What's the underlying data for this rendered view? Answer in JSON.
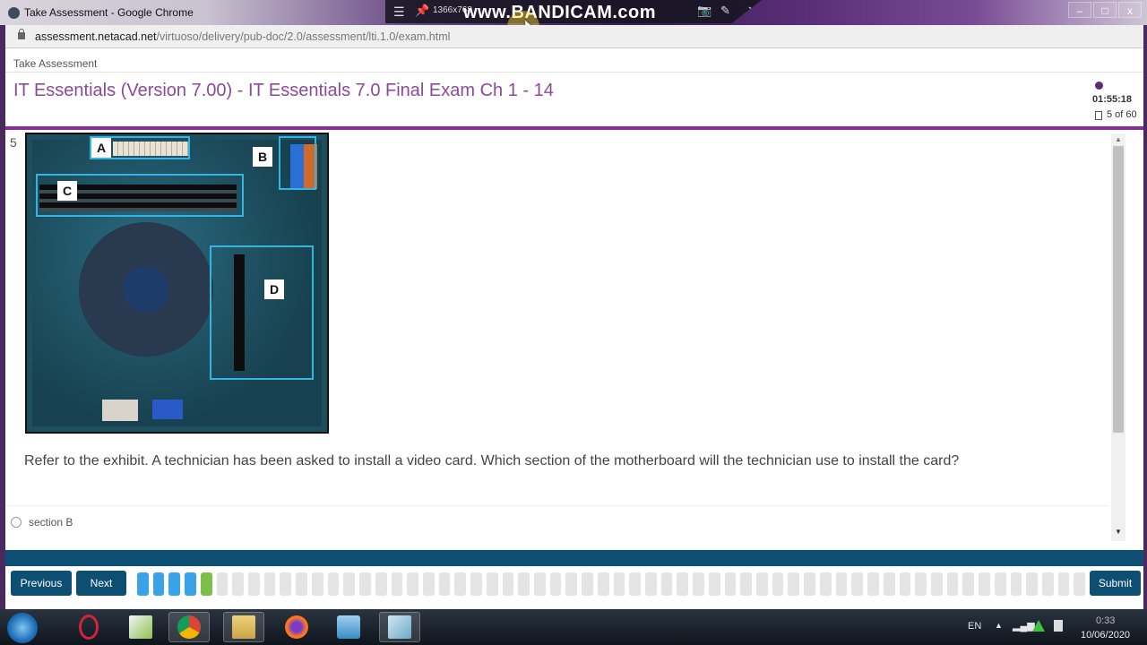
{
  "window": {
    "title": "Take Assessment - Google Chrome",
    "controls": {
      "minimize": "‒",
      "maximize": "□",
      "close": "x"
    }
  },
  "recorder_overlay": {
    "menu_icon": "☰",
    "pin_icon": "📌",
    "resolution": "1366x768",
    "brand": "www.BANDICAM.com",
    "camera_icon": "📷",
    "pen_icon": "✎",
    "close_icon": "✕"
  },
  "address_bar": {
    "host": "assessment.netacad.net",
    "path": "/virtuoso/delivery/pub-doc/2.0/assessment/lti.1.0/exam.html"
  },
  "header": {
    "breadcrumb": "Take Assessment",
    "exam_title": "IT Essentials (Version 7.00) - IT Essentials 7.0 Final Exam Ch 1 - 14",
    "timer": "01:55:18",
    "question_counter": "5 of 60",
    "accent_color": "#8a2d9a"
  },
  "question": {
    "number": "5",
    "exhibit": {
      "alt": "Motherboard with labeled sections",
      "labels": [
        "A",
        "B",
        "C",
        "D"
      ]
    },
    "text": "Refer to the exhibit. A technician has been asked to install a video card. Which section of the motherboard will the technician use to install the card?",
    "options": [
      {
        "label": "section B",
        "selected": false
      }
    ]
  },
  "scrollbar": {
    "up": "▲",
    "down": "▼"
  },
  "footer": {
    "previous_label": "Previous",
    "next_label": "Next",
    "submit_label": "Submit",
    "progress": {
      "total": 60,
      "answered": 4,
      "current": 5,
      "colors": {
        "answered": "#3aa2e6",
        "current": "#7cc04a",
        "unanswered": "#e4e4e4"
      }
    }
  },
  "taskbar": {
    "apps": [
      "Windows Start",
      "Opera",
      "Notepad++",
      "Google Chrome",
      "File Explorer",
      "Firefox",
      "Media Player",
      "Notepad"
    ],
    "tray": {
      "language": "EN",
      "show_hidden": "▲",
      "time": "0:33",
      "date": "10/06/2020"
    }
  }
}
